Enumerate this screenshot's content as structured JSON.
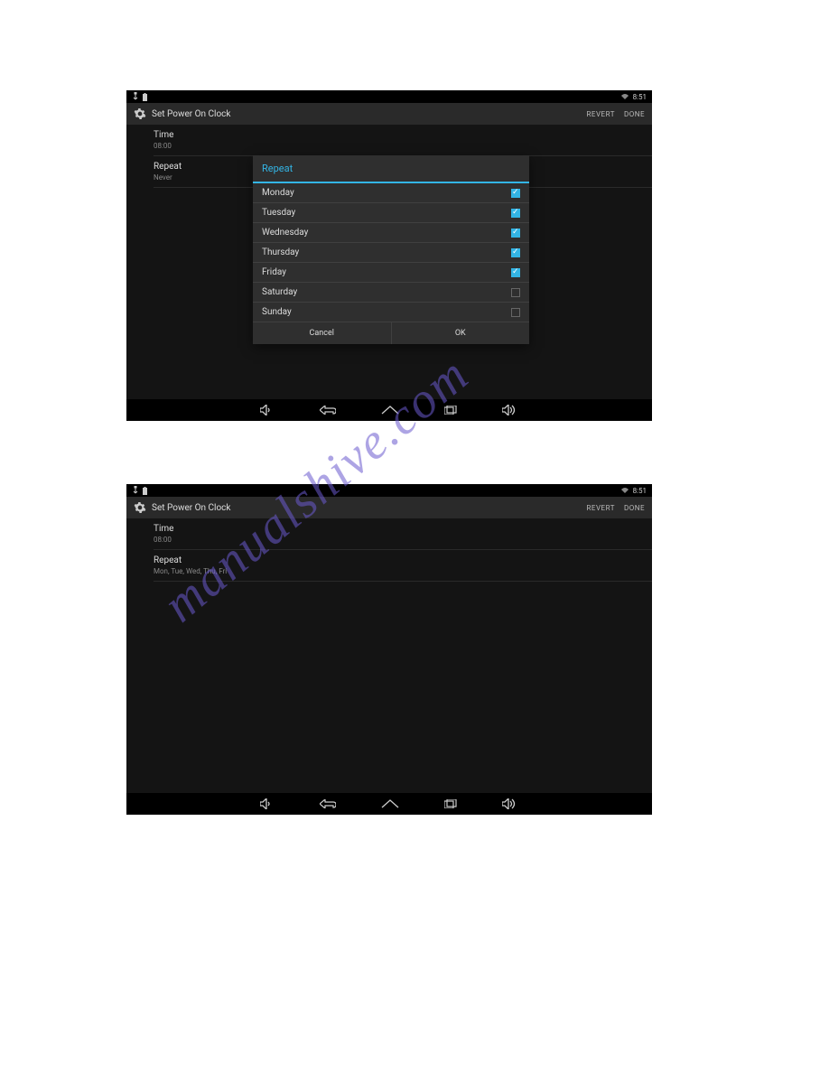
{
  "watermark": "manualshive.com",
  "status": {
    "time": "8:51"
  },
  "screen1": {
    "header": {
      "title": "Set Power On Clock",
      "revert": "REVERT",
      "done": "DONE"
    },
    "items": {
      "time": {
        "title": "Time",
        "value": "08:00"
      },
      "repeat": {
        "title": "Repeat",
        "value": "Never"
      }
    },
    "dialog": {
      "title": "Repeat",
      "days": [
        {
          "label": "Monday",
          "checked": true
        },
        {
          "label": "Tuesday",
          "checked": true
        },
        {
          "label": "Wednesday",
          "checked": true
        },
        {
          "label": "Thursday",
          "checked": true
        },
        {
          "label": "Friday",
          "checked": true
        },
        {
          "label": "Saturday",
          "checked": false
        },
        {
          "label": "Sunday",
          "checked": false
        }
      ],
      "cancel": "Cancel",
      "ok": "OK"
    }
  },
  "screen2": {
    "header": {
      "title": "Set Power On Clock",
      "revert": "REVERT",
      "done": "DONE"
    },
    "items": {
      "time": {
        "title": "Time",
        "value": "08:00"
      },
      "repeat": {
        "title": "Repeat",
        "value": "Mon, Tue, Wed, Thu, Fri"
      }
    }
  }
}
